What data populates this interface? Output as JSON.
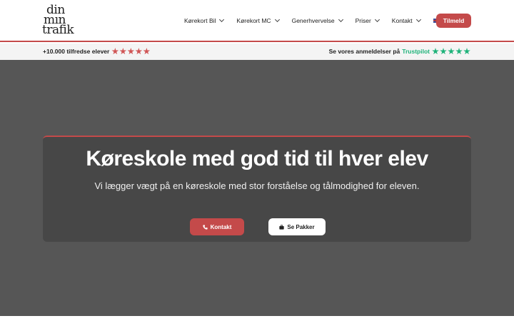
{
  "logo": {
    "line1": "din",
    "line2": "mın",
    "line3": "trafik"
  },
  "nav": {
    "items": [
      {
        "label": "Kørekort Bil"
      },
      {
        "label": "Kørekort MC"
      },
      {
        "label": "Generhvervelse"
      },
      {
        "label": "Priser"
      },
      {
        "label": "Kontakt"
      }
    ],
    "language_icon": "uk-flag-icon",
    "signup_label": "Tilmeld"
  },
  "subbar": {
    "left_text": "+10.000 tilfredse elever",
    "left_stars": 5,
    "right_text": "Se vores anmeldelser på",
    "right_brand": "Trustpilot",
    "right_stars": 5
  },
  "hero": {
    "title": "Køreskole med god tid til hver elev",
    "subtitle": "Vi lægger vægt på en køreskole med stor forståelse og tålmodighed for eleven.",
    "contact_label": "Kontakt",
    "packages_label": "Se Pakker"
  },
  "colors": {
    "accent": "#c44a4a",
    "trustpilot": "#1fb37a",
    "hero_bg": "#565656",
    "card_bg": "#474747"
  }
}
